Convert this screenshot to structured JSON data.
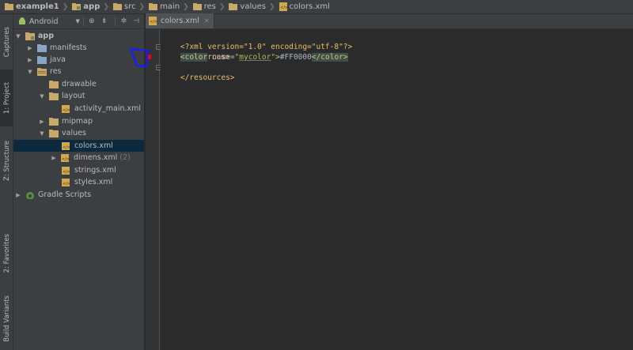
{
  "breadcrumb": {
    "items": [
      {
        "label": "example1",
        "bold": true
      },
      {
        "label": "app",
        "bold": true
      },
      {
        "label": "src",
        "bold": false
      },
      {
        "label": "main",
        "bold": false
      },
      {
        "label": "res",
        "bold": false
      },
      {
        "label": "values",
        "bold": false
      },
      {
        "label": "colors.xml",
        "bold": false
      }
    ]
  },
  "left_strip": {
    "tabs": [
      {
        "label": "Captures"
      },
      {
        "label": "1: Project"
      },
      {
        "label": "Z: Structure"
      },
      {
        "label": "2: Favorites"
      },
      {
        "label": "Build Variants"
      }
    ]
  },
  "project_toolbar": {
    "view_mode": "Android"
  },
  "tree": {
    "rows": [
      {
        "label": "app",
        "bold": true
      },
      {
        "label": "manifests"
      },
      {
        "label": "java"
      },
      {
        "label": "res"
      },
      {
        "label": "drawable"
      },
      {
        "label": "layout"
      },
      {
        "label": "activity_main.xml"
      },
      {
        "label": "mipmap"
      },
      {
        "label": "values"
      },
      {
        "label": "colors.xml"
      },
      {
        "label": "dimens.xml",
        "count": "(2)"
      },
      {
        "label": "strings.xml"
      },
      {
        "label": "styles.xml"
      },
      {
        "label": "Gradle Scripts"
      }
    ]
  },
  "editor": {
    "tab_label": "colors.xml",
    "lines": {
      "l1": {
        "pi": "<?xml version=\"1.0\" encoding=\"utf-8\"?>"
      },
      "l2": {
        "open": "<resources>"
      },
      "l3": {
        "indent": "    ",
        "tag_open": "<color",
        "attr": " name=",
        "quote_open": "\"",
        "value": "mycolor",
        "quote_close": "\"",
        "close_bracket": ">",
        "text": "#FF0000",
        "tag_close": "</color>"
      },
      "l4": {
        "close": "</resources>"
      }
    },
    "swatch_color": "#FF0000"
  },
  "colors": {
    "annotation": "#1a1aff",
    "selection": "#0d293e"
  }
}
